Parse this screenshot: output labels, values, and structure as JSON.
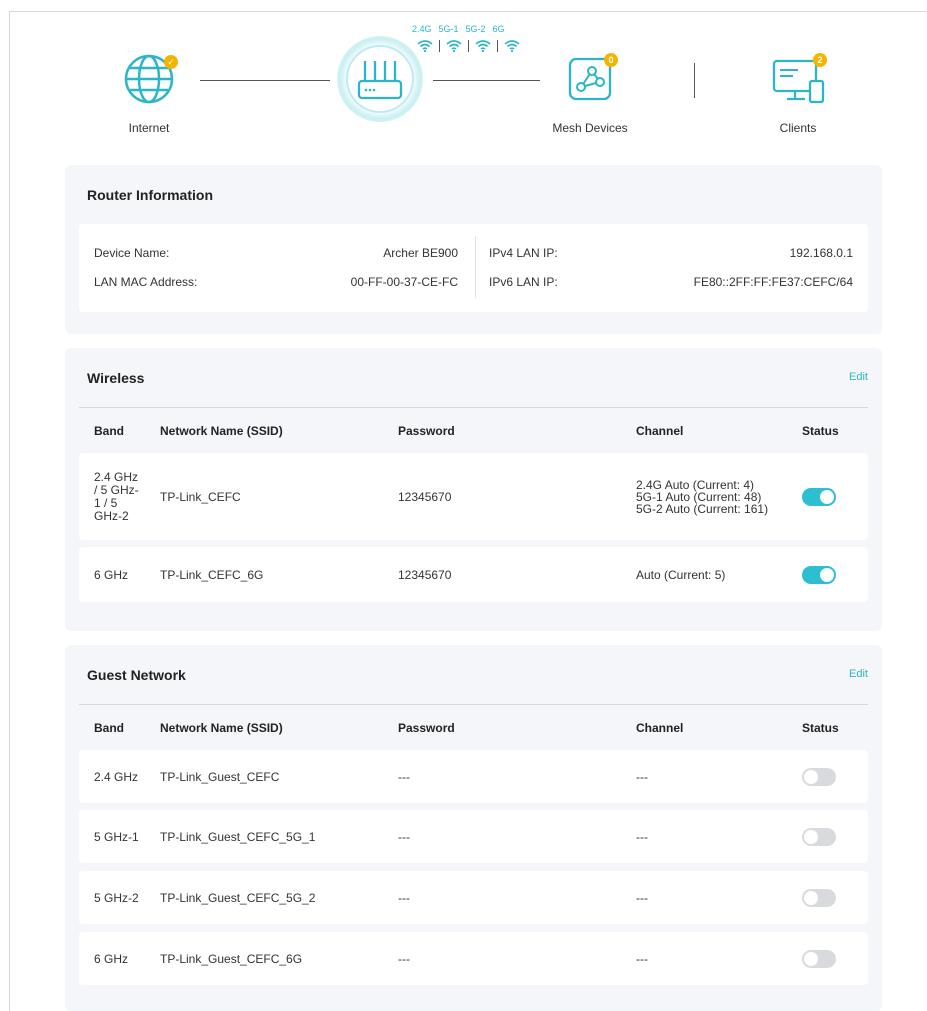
{
  "topology": {
    "internet_label": "Internet",
    "mesh_label": "Mesh Devices",
    "clients_label": "Clients",
    "mesh_count": "0",
    "clients_count": "2",
    "bands": [
      "2.4G",
      "5G-1",
      "5G-2",
      "6G"
    ]
  },
  "router_info": {
    "title": "Router Information",
    "device_name_label": "Device Name:",
    "device_name_value": "Archer BE900",
    "lan_mac_label": "LAN MAC Address:",
    "lan_mac_value": "00-FF-00-37-CE-FC",
    "ipv4_label": "IPv4 LAN IP:",
    "ipv4_value": "192.168.0.1",
    "ipv6_label": "IPv6 LAN IP:",
    "ipv6_value": "FE80::2FF:FF:FE37:CEFC/64"
  },
  "wireless": {
    "title": "Wireless",
    "edit_label": "Edit",
    "headers": {
      "band": "Band",
      "ssid": "Network Name (SSID)",
      "password": "Password",
      "channel": "Channel",
      "status": "Status"
    },
    "rows": [
      {
        "band": "2.4 GHz / 5 GHz-1 / 5 GHz-2",
        "ssid": "TP-Link_CEFC",
        "password": "12345670",
        "channel": "2.4G Auto (Current: 4)\n5G-1 Auto (Current: 48)\n5G-2 Auto (Current: 161)",
        "enabled": true
      },
      {
        "band": "6 GHz",
        "ssid": "TP-Link_CEFC_6G",
        "password": "12345670",
        "channel": "Auto (Current: 5)",
        "enabled": true
      }
    ]
  },
  "guest": {
    "title": "Guest Network",
    "edit_label": "Edit",
    "headers": {
      "band": "Band",
      "ssid": "Network Name (SSID)",
      "password": "Password",
      "channel": "Channel",
      "status": "Status"
    },
    "rows": [
      {
        "band": "2.4 GHz",
        "ssid": "TP-Link_Guest_CEFC",
        "password": "---",
        "channel": "---",
        "enabled": false
      },
      {
        "band": "5 GHz-1",
        "ssid": "TP-Link_Guest_CEFC_5G_1",
        "password": "---",
        "channel": "---",
        "enabled": false
      },
      {
        "band": "5 GHz-2",
        "ssid": "TP-Link_Guest_CEFC_5G_2",
        "password": "---",
        "channel": "---",
        "enabled": false
      },
      {
        "band": "6 GHz",
        "ssid": "TP-Link_Guest_CEFC_6G",
        "password": "---",
        "channel": "---",
        "enabled": false
      }
    ]
  },
  "icons": {
    "internet": "globe-icon",
    "router": "router-icon",
    "mesh": "mesh-icon",
    "clients": "clients-icon",
    "wifi": "wifi-icon",
    "check": "check-icon"
  },
  "colors": {
    "accent": "#2bbfd0",
    "badge": "#f5b400",
    "card_bg": "#f4f6f9",
    "toggle_off": "#d8dadd"
  }
}
